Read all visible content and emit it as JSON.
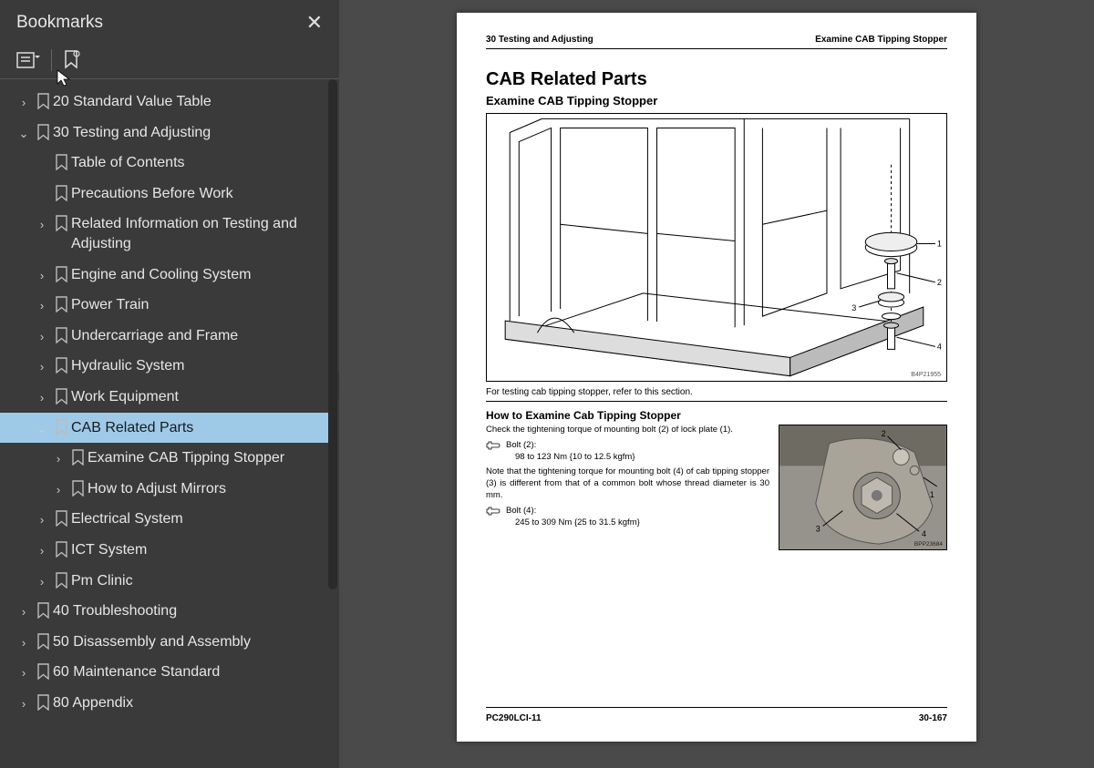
{
  "sidebar": {
    "title": "Bookmarks",
    "close": "✕",
    "nodes": [
      {
        "lvl": 0,
        "chev": "›",
        "label": "20 Standard Value Table"
      },
      {
        "lvl": 0,
        "chev": "⌄",
        "label": "30 Testing and Adjusting"
      },
      {
        "lvl": 1,
        "chev": "",
        "label": "Table of Contents"
      },
      {
        "lvl": 1,
        "chev": "",
        "label": "Precautions Before Work"
      },
      {
        "lvl": 1,
        "chev": "›",
        "label": "Related Information on Testing and Adjusting"
      },
      {
        "lvl": 1,
        "chev": "›",
        "label": "Engine and Cooling System"
      },
      {
        "lvl": 1,
        "chev": "›",
        "label": "Power Train"
      },
      {
        "lvl": 1,
        "chev": "›",
        "label": "Undercarriage and Frame"
      },
      {
        "lvl": 1,
        "chev": "›",
        "label": "Hydraulic System"
      },
      {
        "lvl": 1,
        "chev": "›",
        "label": "Work Equipment"
      },
      {
        "lvl": 1,
        "chev": "⌄",
        "label": "CAB Related Parts",
        "selected": true
      },
      {
        "lvl": 2,
        "chev": "›",
        "label": "Examine CAB Tipping Stopper"
      },
      {
        "lvl": 2,
        "chev": "›",
        "label": "How to Adjust Mirrors"
      },
      {
        "lvl": 1,
        "chev": "›",
        "label": "Electrical System"
      },
      {
        "lvl": 1,
        "chev": "›",
        "label": "ICT System"
      },
      {
        "lvl": 1,
        "chev": "›",
        "label": "Pm Clinic"
      },
      {
        "lvl": 0,
        "chev": "›",
        "label": "40 Troubleshooting"
      },
      {
        "lvl": 0,
        "chev": "›",
        "label": "50 Disassembly and Assembly"
      },
      {
        "lvl": 0,
        "chev": "›",
        "label": "60 Maintenance Standard"
      },
      {
        "lvl": 0,
        "chev": "›",
        "label": "80 Appendix"
      }
    ]
  },
  "page": {
    "header_left": "30 Testing and Adjusting",
    "header_right": "Examine CAB Tipping Stopper",
    "h1": "CAB Related Parts",
    "h2": "Examine CAB Tipping Stopper",
    "fig1_id": "B4P21955",
    "caption": "For testing cab tipping stopper, refer to this section.",
    "h3": "How to Examine Cab Tipping Stopper",
    "para1": "Check the tightening torque of mounting bolt (2) of lock plate (1).",
    "spec1_name": "Bolt (2):",
    "spec1_val": "98 to 123 Nm {10 to 12.5 kgfm}",
    "para2": "Note that the tightening torque for mounting bolt (4) of cab tipping stopper (3) is different from that of a common bolt whose thread diameter is 30 mm.",
    "spec2_name": "Bolt (4):",
    "spec2_val": "245 to 309 Nm {25 to 31.5 kgfm}",
    "fig2_id": "BPP23684",
    "footer_left": "PC290LCI-11",
    "footer_right": "30-167"
  }
}
